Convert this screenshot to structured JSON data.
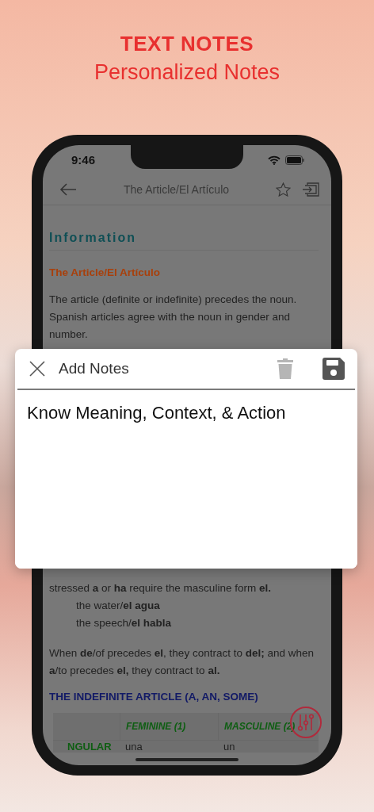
{
  "promo": {
    "title": "TEXT NOTES",
    "subtitle": "Personalized Notes"
  },
  "status_bar": {
    "time": "9:46"
  },
  "nav_bar": {
    "title": "The Article/El Artículo",
    "favorite": false
  },
  "content_top": [
    {
      "kind": "section",
      "text": "Information"
    },
    {
      "kind": "heading",
      "text": "The Article/El Artículo"
    },
    {
      "kind": "paragraph",
      "text": "The article (definite or indefinite) precedes the noun. Spanish articles agree with the noun in gender and number."
    }
  ],
  "content_bottom": [
    {
      "kind": "paragraph",
      "text": "stressed **a** or **ha** require the masculine form **el.**"
    },
    {
      "kind": "example",
      "text": "the water/**el agua**"
    },
    {
      "kind": "example",
      "text": "the speech/**el habla**"
    },
    {
      "kind": "paragraph",
      "text": "When **de**/of precedes **el**, they contract to **del;** and when **a**/to precedes **el,** they contract to **al.**"
    },
    {
      "kind": "subheading",
      "text": "THE INDEFINITE ARTICLE (A, AN, SOME)"
    }
  ],
  "table": {
    "columns": [
      "FEMININE (1)",
      "MASCULINE (2)"
    ],
    "rows": [
      {
        "label": "NGULAR",
        "cells": [
          "una",
          "un"
        ]
      }
    ]
  },
  "notes_dialog": {
    "title": "Add Notes",
    "value": "Know Meaning, Context, & Action",
    "delete_disabled": true
  }
}
